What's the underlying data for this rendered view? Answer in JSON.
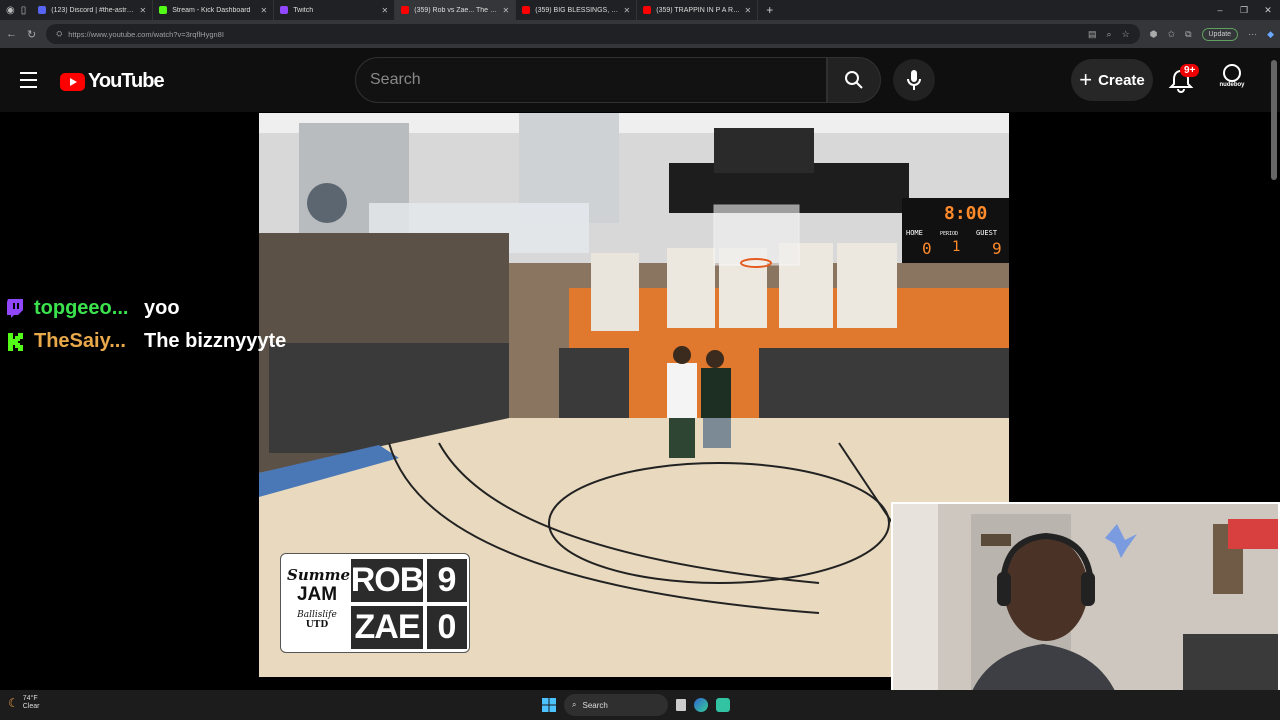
{
  "browser": {
    "tabs": [
      {
        "label": "(123) Discord | #the-astronomic...",
        "color": "#5865f2",
        "active": false
      },
      {
        "label": "Stream - Kick Dashboard",
        "color": "#53fc18",
        "active": false
      },
      {
        "label": "Twitch",
        "color": "#9146ff",
        "active": false
      },
      {
        "label": "(359) Rob vs Zae... The GREA",
        "color": "#ff0000",
        "active": true
      },
      {
        "label": "(359) BIG BLESSINGS, LETS STRE",
        "color": "#ff0000",
        "active": false
      },
      {
        "label": "(359) TRAPPIN IN P A R A D I S",
        "color": "#ff0000",
        "active": false
      }
    ],
    "new_tab_label": "+",
    "url": "https://www.youtube.com/watch?v=3rqflHygn8I",
    "update_label": "Update"
  },
  "youtube": {
    "logo_text": "YouTube",
    "search_placeholder": "Search",
    "create_label": "Create",
    "notification_count": "9+",
    "avatar_label": "nudeboy"
  },
  "scoreboard": {
    "logo_line1": "Summer",
    "logo_line2": "JAM",
    "logo_line3": "Ballislife",
    "logo_line4": "UTD",
    "teams": [
      {
        "name": "ROB",
        "score": "9"
      },
      {
        "name": "ZAE",
        "score": "0"
      }
    ]
  },
  "chat": [
    {
      "platform": "twitch",
      "platform_color": "#9146ff",
      "user": "topgeeo...",
      "user_color": "#3be24d",
      "message": "yoo"
    },
    {
      "platform": "kick",
      "platform_color": "#53fc18",
      "user": "TheSaiy...",
      "user_color": "#e9a84a",
      "message": "The bizznyyyte"
    }
  ],
  "court_scoreboard": {
    "clock": "8:00",
    "home_label": "HOME",
    "period_label": "PERIOD",
    "guest_label": "GUEST",
    "home_score": "0",
    "period": "1",
    "guest_score": "9"
  },
  "taskbar": {
    "weather_temp": "74°F",
    "weather_desc": "Clear",
    "search_label": "Search"
  }
}
